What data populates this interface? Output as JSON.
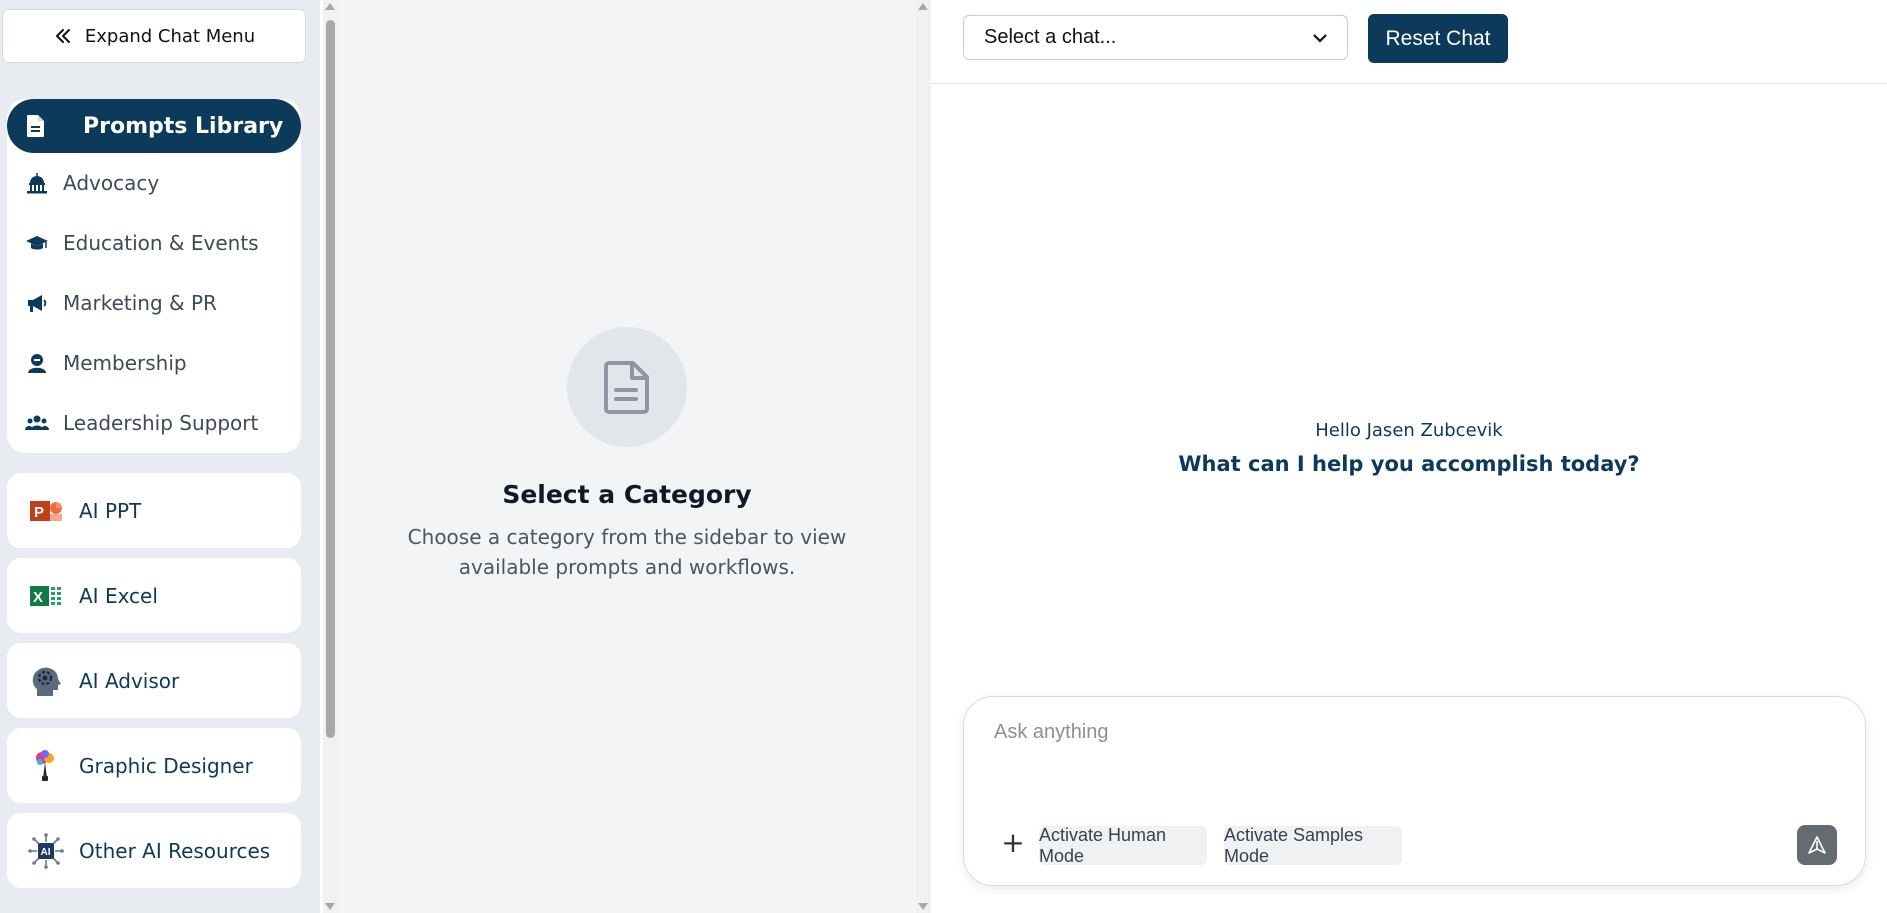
{
  "sidebar": {
    "expand_label": "Expand Chat Menu",
    "prompts_library": {
      "title": "Prompts Library",
      "categories": [
        {
          "label": "Advocacy",
          "icon": "capitol-icon"
        },
        {
          "label": "Education & Events",
          "icon": "graduation-cap-icon"
        },
        {
          "label": "Marketing & PR",
          "icon": "megaphone-icon"
        },
        {
          "label": "Membership",
          "icon": "user-badge-icon"
        },
        {
          "label": "Leadership Support",
          "icon": "users-icon"
        }
      ]
    },
    "tools": [
      {
        "label": "AI PPT",
        "icon": "powerpoint-icon"
      },
      {
        "label": "AI Excel",
        "icon": "excel-icon"
      },
      {
        "label": "AI Advisor",
        "icon": "brain-gear-icon"
      },
      {
        "label": "Graphic Designer",
        "icon": "paintbrush-icon"
      },
      {
        "label": "Other AI Resources",
        "icon": "ai-chip-icon"
      }
    ]
  },
  "middle": {
    "title": "Select a Category",
    "description": "Choose a category from the sidebar to view available prompts and workflows."
  },
  "chat": {
    "select_placeholder": "Select a chat...",
    "reset_label": "Reset Chat",
    "greeting": "Hello Jasen Zubcevik",
    "question": "What can I help you accomplish today?",
    "input_placeholder": "Ask anything",
    "plus_label": "+",
    "human_mode_label": "Activate Human Mode",
    "samples_mode_label": "Activate Samples Mode"
  },
  "colors": {
    "brand_navy": "#0b3a5b",
    "sidebar_bg": "#e8ebef",
    "middle_bg": "#f3f4f6",
    "send_button": "#666b72"
  }
}
